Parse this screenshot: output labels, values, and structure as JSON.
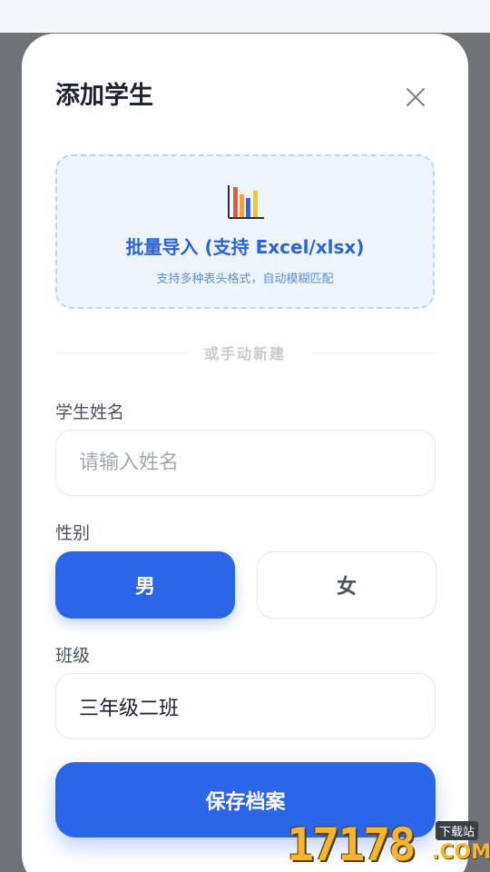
{
  "dialog": {
    "title": "添加学生"
  },
  "import": {
    "title": "批量导入 (支持 Excel/xlsx)",
    "subtitle": "支持多种表头格式，自动模糊匹配",
    "icon": "bar-chart-icon"
  },
  "divider": {
    "text": "或手动新建"
  },
  "form": {
    "name_label": "学生姓名",
    "name_placeholder": "请输入姓名",
    "name_value": "",
    "gender_label": "性别",
    "gender_options": [
      "男",
      "女"
    ],
    "gender_selected": "男",
    "class_label": "班级",
    "class_value": "三年级二班"
  },
  "actions": {
    "save_label": "保存档案"
  },
  "watermark": {
    "digits": "17178",
    "domain": ".COM",
    "tag": "下载站"
  },
  "colors": {
    "accent": "#2b66e8",
    "import_bg": "#eef5ff",
    "import_border": "#b9d6f5"
  }
}
